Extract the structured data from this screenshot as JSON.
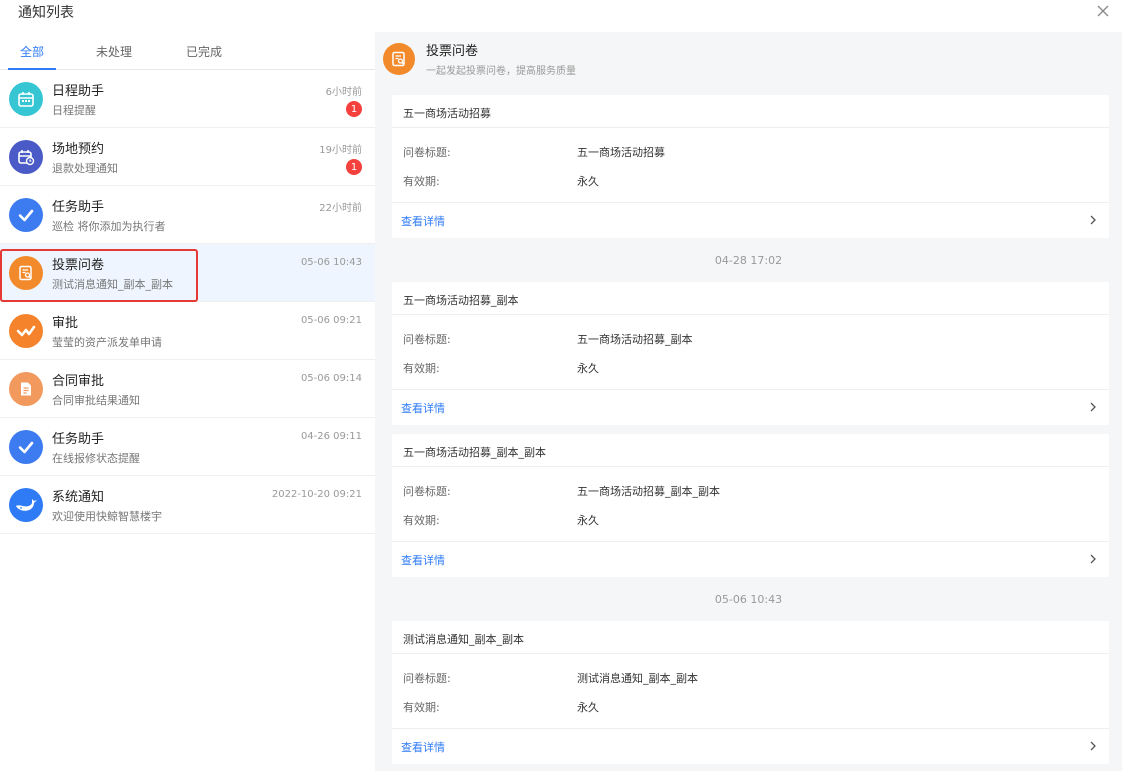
{
  "window": {
    "title": "通知列表",
    "close_icon": "close-icon"
  },
  "tabs": [
    {
      "label": "全部",
      "active": true
    },
    {
      "label": "未处理",
      "active": false
    },
    {
      "label": "已完成",
      "active": false
    }
  ],
  "items": [
    {
      "name": "日程助手",
      "sub": "日程提醒",
      "time": "6小时前",
      "badge": "1",
      "color": "#36c6d3",
      "icon": "calendar-icon"
    },
    {
      "name": "场地预约",
      "sub": "退款处理通知",
      "time": "19小时前",
      "badge": "1",
      "color": "#4a5bc7",
      "icon": "calendar-clock-icon"
    },
    {
      "name": "任务助手",
      "sub": "巡检 将你添加为执行者",
      "time": "22小时前",
      "badge": "",
      "color": "#3d7bf0",
      "icon": "check-icon"
    },
    {
      "name": "投票问卷",
      "sub": "测试消息通知_副本_副本",
      "time": "05-06 10:43",
      "badge": "",
      "color": "#f28a2c",
      "icon": "survey-icon"
    },
    {
      "name": "审批",
      "sub": "莹莹的资产派发单申请",
      "time": "05-06 09:21",
      "badge": "",
      "color": "#f5832c",
      "icon": "approval-icon"
    },
    {
      "name": "合同审批",
      "sub": "合同审批结果通知",
      "time": "05-06 09:14",
      "badge": "",
      "color": "#f29a5e",
      "icon": "contract-icon"
    },
    {
      "name": "任务助手",
      "sub": "在线报修状态提醒",
      "time": "04-26 09:11",
      "badge": "",
      "color": "#3d7bf0",
      "icon": "check-icon"
    },
    {
      "name": "系统通知",
      "sub": "欢迎使用快鲸智慧楼宇",
      "time": "2022-10-20 09:21",
      "badge": "",
      "color": "#2f7bf5",
      "icon": "whale-icon"
    }
  ],
  "detail": {
    "header": {
      "title": "投票问卷",
      "subtitle": "一起发起投票问卷，提高服务质量"
    },
    "labels": {
      "survey_title": "问卷标题:",
      "valid": "有效期:",
      "view": "查看详情"
    },
    "cards": [
      {
        "title": "五一商场活动招募",
        "survey_title": "五一商场活动招募",
        "valid": "永久"
      },
      {
        "title": "五一商场活动招募_副本",
        "survey_title": "五一商场活动招募_副本",
        "valid": "永久"
      },
      {
        "title": "五一商场活动招募_副本_副本",
        "survey_title": "五一商场活动招募_副本_副本",
        "valid": "永久"
      },
      {
        "title": "测试消息通知_副本_副本",
        "survey_title": "测试消息通知_副本_副本",
        "valid": "永久"
      }
    ],
    "timestamps": [
      "04-28 17:02",
      "05-06 10:43"
    ]
  }
}
